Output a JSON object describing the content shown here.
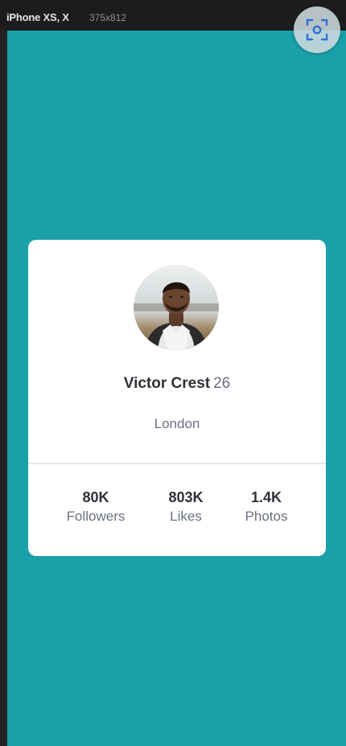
{
  "device_bar": {
    "device_name": "iPhone XS, X",
    "device_size": "375x812"
  },
  "capture_button": {
    "icon": "screenshot-capture-icon"
  },
  "profile": {
    "name": "Victor Crest",
    "age": "26",
    "city": "London",
    "stats": [
      {
        "value": "80K",
        "label": "Followers"
      },
      {
        "value": "803K",
        "label": "Likes"
      },
      {
        "value": "1.4K",
        "label": "Photos"
      }
    ]
  },
  "colors": {
    "background": "#19a0a9",
    "card": "#ffffff",
    "primary_text": "#2e3238",
    "secondary_text": "#6b7082"
  }
}
